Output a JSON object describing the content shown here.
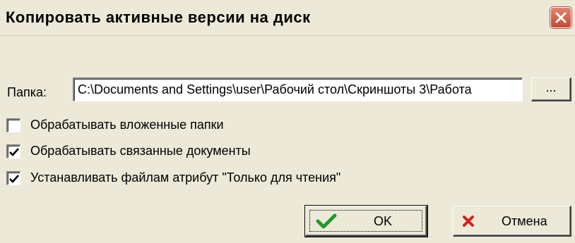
{
  "window": {
    "title": "Копировать активные версии на диск",
    "close_icon": "close-icon"
  },
  "folder": {
    "label": "Папка:",
    "value": "C:\\Documents and Settings\\user\\Рабочий стол\\Скриншоты 3\\Работа",
    "browse_label": "..."
  },
  "options": [
    {
      "label": "Обрабатывать вложенные папки",
      "checked": false
    },
    {
      "label": "Обрабатывать связанные документы",
      "checked": true
    },
    {
      "label": "Устанавливать файлам атрибут \"Только для чтения\"",
      "checked": true
    }
  ],
  "buttons": {
    "ok_label": "OK",
    "ok_icon": "checkmark-icon",
    "ok_icon_color": "#1e9a2c",
    "cancel_label": "Отмена",
    "cancel_icon": "cross-icon",
    "cancel_icon_color": "#d81e1e"
  }
}
